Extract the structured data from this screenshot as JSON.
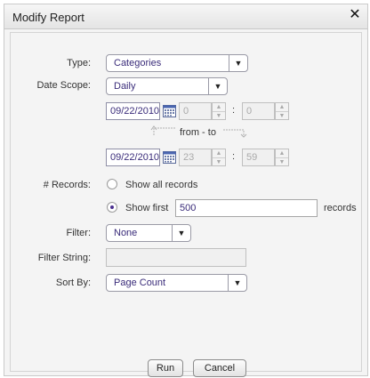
{
  "dialog": {
    "title": "Modify Report",
    "close_icon": "close-icon"
  },
  "type": {
    "label": "Type:",
    "value": "Categories"
  },
  "date_scope": {
    "label": "Date Scope:",
    "value": "Daily",
    "start": {
      "date": "09/22/2010",
      "hour": "0",
      "minute": "0"
    },
    "from_to": "from - to",
    "end": {
      "date": "09/22/2010",
      "hour": "23",
      "minute": "59"
    },
    "separator": ":"
  },
  "records": {
    "label": "# Records:",
    "show_all_label": "Show all records",
    "show_first_label": "Show first",
    "show_first_value": "500",
    "suffix": "records",
    "selected": "show_first"
  },
  "filter": {
    "label": "Filter:",
    "value": "None"
  },
  "filter_string": {
    "label": "Filter String:",
    "value": ""
  },
  "sort_by": {
    "label": "Sort By:",
    "value": "Page Count"
  },
  "buttons": {
    "run": "Run",
    "cancel": "Cancel"
  },
  "colors": {
    "accent": "#3a2c7a",
    "panel": "#f4f4f4"
  }
}
